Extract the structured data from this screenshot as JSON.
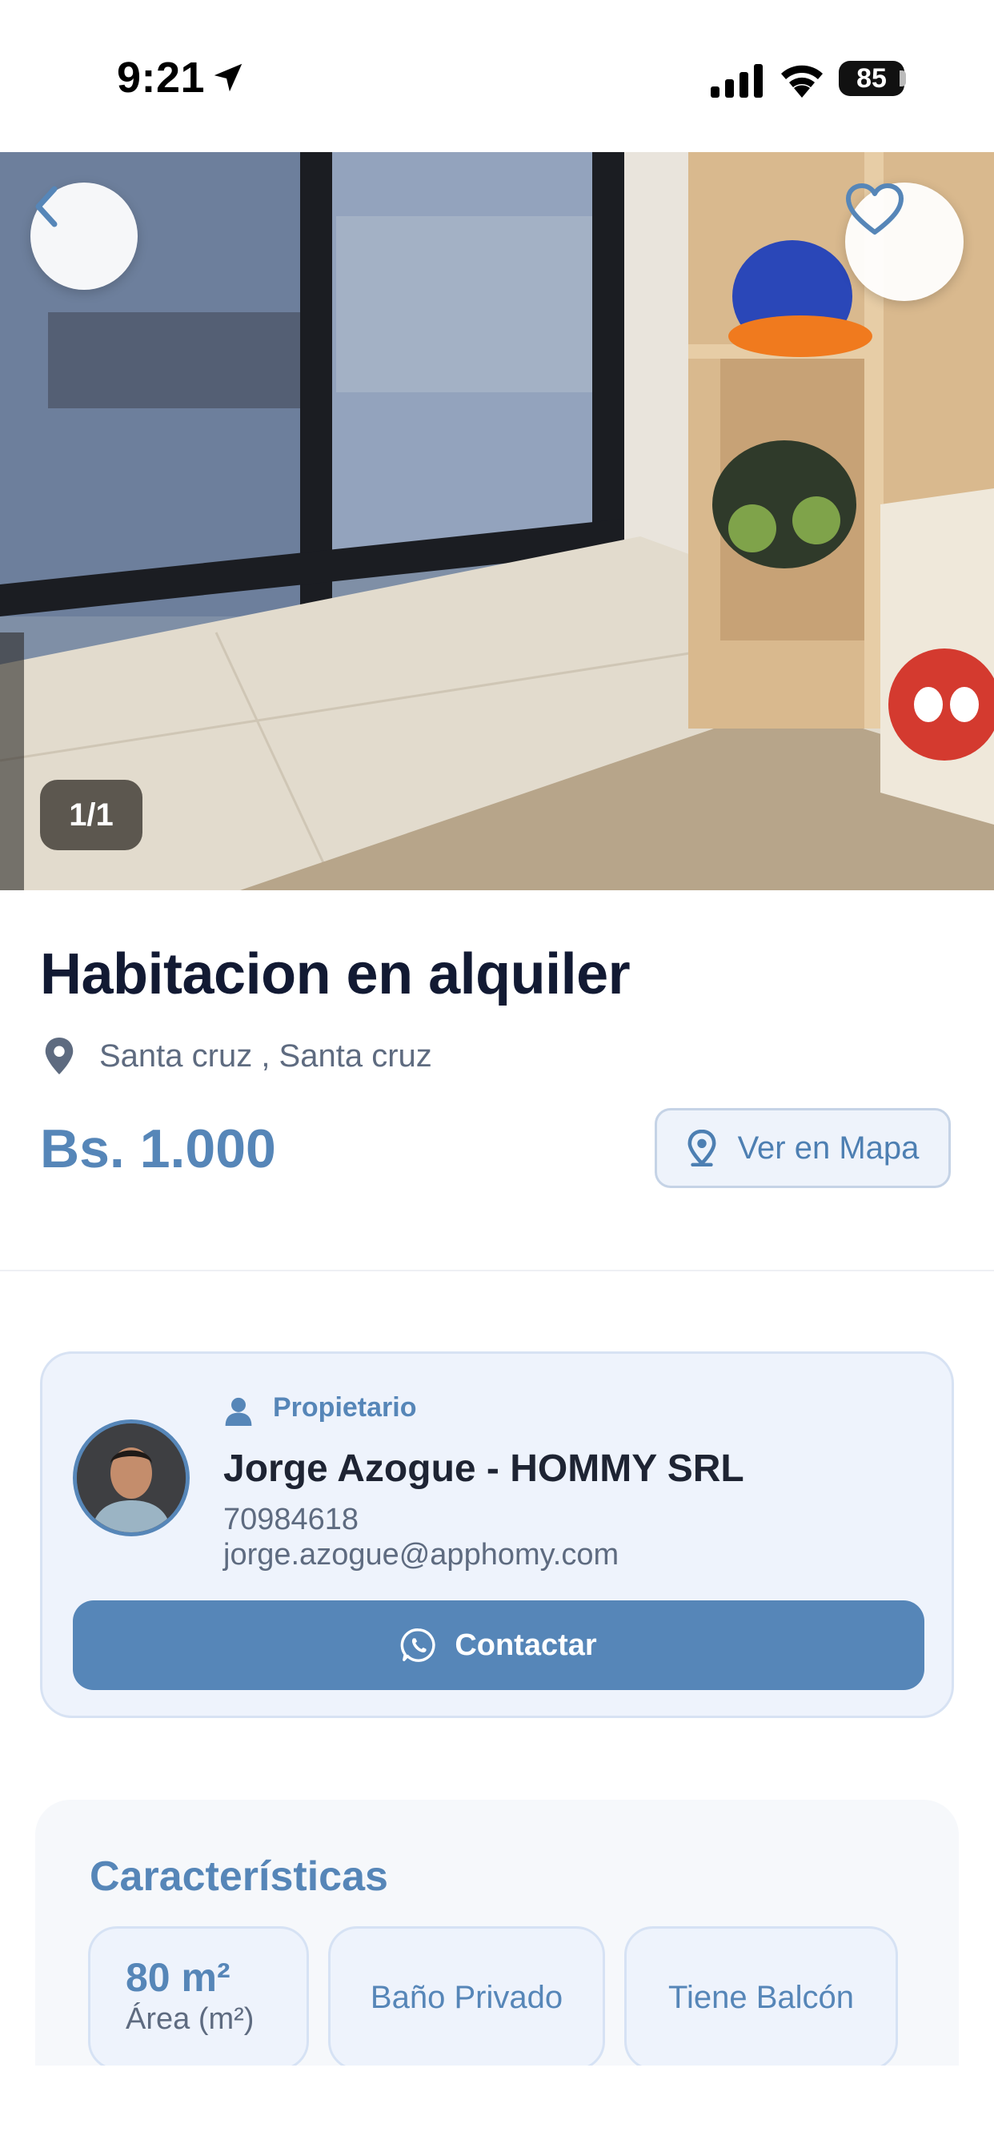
{
  "status_bar": {
    "time": "9:21",
    "battery": "85"
  },
  "gallery": {
    "counter": "1/1"
  },
  "listing": {
    "title": "Habitacion en alquiler",
    "location": "Santa cruz , Santa cruz",
    "price": "Bs. 1.000",
    "map_button": "Ver en Mapa"
  },
  "owner": {
    "role_label": "Propietario",
    "name": "Jorge Azogue - HOMMY SRL",
    "phone": "70984618",
    "email": "jorge.azogue@apphomy.com",
    "contact_button": "Contactar"
  },
  "features": {
    "title": "Características",
    "items": [
      {
        "value": "80 m²",
        "label": "Área (m²)"
      },
      {
        "label": "Baño Privado"
      },
      {
        "label": "Tiene Balcón"
      }
    ]
  },
  "colors": {
    "accent": "#5686b8",
    "title": "#121a33",
    "muted": "#5e6b80",
    "card_bg": "#eef3fc"
  },
  "icons": [
    "location-arrow-icon",
    "signal-icon",
    "wifi-icon",
    "battery-icon",
    "back-chevron-icon",
    "heart-icon",
    "map-pin-icon",
    "person-icon",
    "whatsapp-icon"
  ]
}
